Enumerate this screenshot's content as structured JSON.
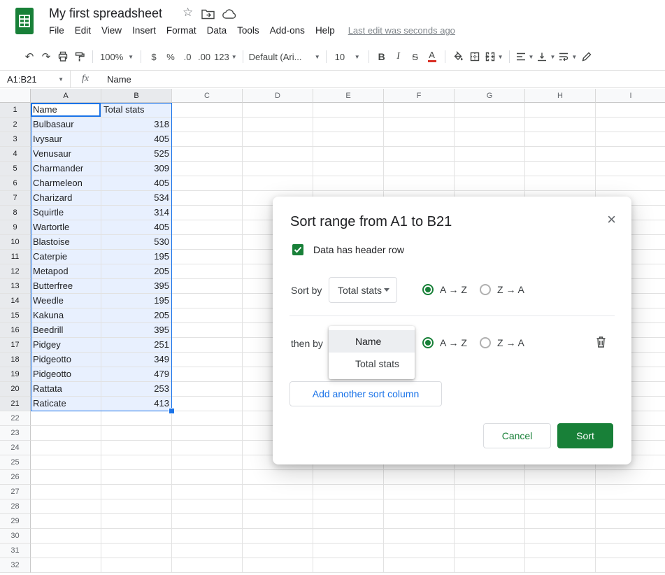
{
  "header": {
    "title": "My first spreadsheet",
    "menu_items": [
      "File",
      "Edit",
      "View",
      "Insert",
      "Format",
      "Data",
      "Tools",
      "Add-ons",
      "Help"
    ],
    "last_edit": "Last edit was seconds ago"
  },
  "toolbar": {
    "zoom": "100%",
    "currency": "$",
    "percent": "%",
    "decimal_decrease": ".0",
    "decimal_increase": ".00",
    "number_format": "123",
    "font_name": "Default (Ari...",
    "font_size": "10",
    "bold": "B",
    "italic": "I",
    "strikethrough": "S",
    "text_color": "A"
  },
  "formula_bar": {
    "name_box": "A1:B21",
    "fx_label": "fx",
    "value": "Name"
  },
  "grid": {
    "columns": [
      "A",
      "B",
      "C",
      "D",
      "E",
      "F",
      "G",
      "H",
      "I"
    ],
    "row_count": 32,
    "data": [
      [
        "Name",
        "Total stats"
      ],
      [
        "Bulbasaur",
        "318"
      ],
      [
        "Ivysaur",
        "405"
      ],
      [
        "Venusaur",
        "525"
      ],
      [
        "Charmander",
        "309"
      ],
      [
        "Charmeleon",
        "405"
      ],
      [
        "Charizard",
        "534"
      ],
      [
        "Squirtle",
        "314"
      ],
      [
        "Wartortle",
        "405"
      ],
      [
        "Blastoise",
        "530"
      ],
      [
        "Caterpie",
        "195"
      ],
      [
        "Metapod",
        "205"
      ],
      [
        "Butterfree",
        "395"
      ],
      [
        "Weedle",
        "195"
      ],
      [
        "Kakuna",
        "205"
      ],
      [
        "Beedrill",
        "395"
      ],
      [
        "Pidgey",
        "251"
      ],
      [
        "Pidgeotto",
        "349"
      ],
      [
        "Pidgeotto",
        "479"
      ],
      [
        "Rattata",
        "253"
      ],
      [
        "Raticate",
        "413"
      ]
    ],
    "selection": {
      "range": "A1:B21",
      "active_cell": "A1",
      "selected_columns": [
        "A",
        "B"
      ],
      "selected_row_start": 1,
      "selected_row_end": 21
    }
  },
  "dialog": {
    "title": "Sort range from A1 to B21",
    "close": "×",
    "header_row_label": "Data has header row",
    "sort_by_label": "Sort by",
    "sort_by_value": "Total stats",
    "then_by_label": "then by",
    "menu_options": [
      "Name",
      "Total stats"
    ],
    "asc_label": "A → Z",
    "desc_label": "Z → A",
    "add_sort_column_label": "Add another sort column",
    "cancel_label": "Cancel",
    "sort_label": "Sort"
  },
  "colors": {
    "brand_green": "#188038",
    "accent_blue": "#1a73e8",
    "selection_tint": "#e8f0fe"
  }
}
